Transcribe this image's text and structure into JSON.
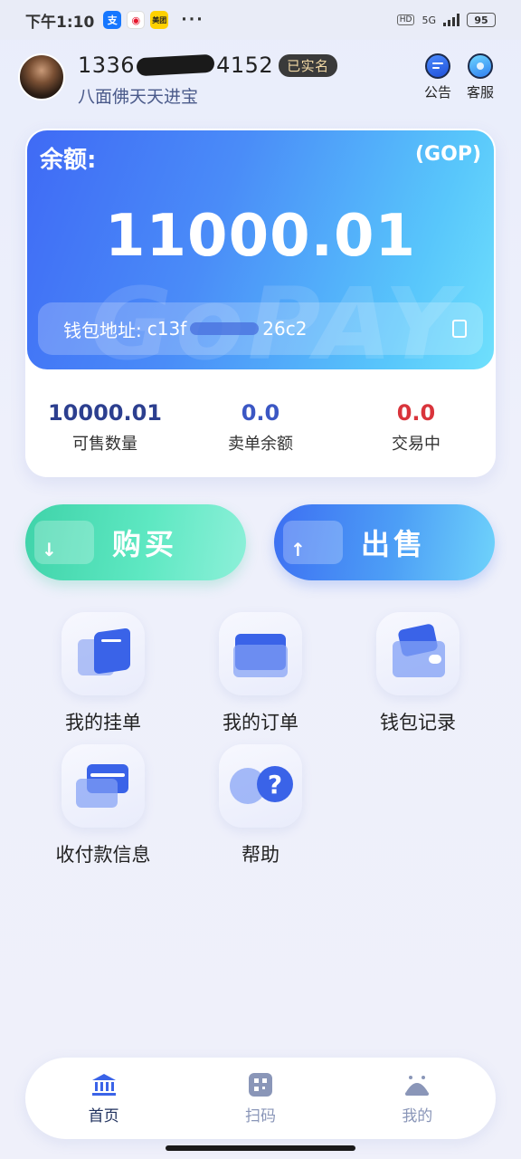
{
  "status_bar": {
    "time": "下午1:10",
    "app_icons": [
      "alipay",
      "weibo",
      "meituan"
    ],
    "meituan_label": "美团",
    "dots": "···",
    "hd": "HD",
    "network": "5G",
    "battery": "95"
  },
  "header": {
    "phone_prefix": "1336",
    "phone_suffix": "4152",
    "verified_label": "已实名",
    "nickname": "八面佛天天进宝",
    "notice_label": "公告",
    "service_label": "客服"
  },
  "balance": {
    "label": "余额:",
    "currency": "(GOP)",
    "amount": "11000.01",
    "wallet_label": "钱包地址:",
    "wallet_prefix": "c13f",
    "wallet_suffix": "26c2",
    "watermark": "GoPAY"
  },
  "stats": [
    {
      "value": "10000.01",
      "label": "可售数量",
      "color": "#2c3f8f"
    },
    {
      "value": "0.0",
      "label": "卖单余额",
      "color": "#3b57c4"
    },
    {
      "value": "0.0",
      "label": "交易中",
      "color": "#d9343b"
    }
  ],
  "actions": {
    "buy_label": "购买",
    "sell_label": "出售"
  },
  "menu": [
    {
      "label": "我的挂单"
    },
    {
      "label": "我的订单"
    },
    {
      "label": "钱包记录"
    },
    {
      "label": "收付款信息"
    },
    {
      "label": "帮助"
    }
  ],
  "bottom_nav": [
    {
      "label": "首页",
      "active": true
    },
    {
      "label": "扫码",
      "active": false
    },
    {
      "label": "我的",
      "active": false
    }
  ],
  "colors": {
    "accent_blue": "#3f6af5",
    "buy_green": "#3fd3a9",
    "danger_red": "#d9343b"
  }
}
